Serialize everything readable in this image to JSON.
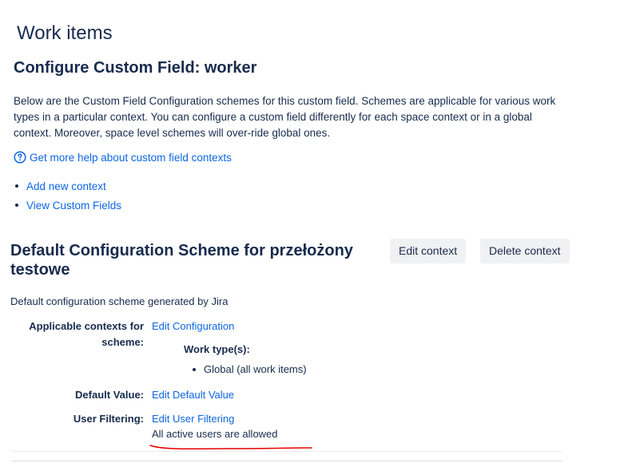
{
  "page": {
    "title": "Work items"
  },
  "section": {
    "title": "Configure Custom Field: worker",
    "intro": "Below are the Custom Field Configuration schemes for this custom field. Schemes are applicable for various work types in a particular context. You can configure a custom field differently for each space context or in a global context. Moreover, space level schemes will over-ride global ones.",
    "help_link": "Get more help about custom field contexts",
    "help_icon": "question-circle-icon",
    "links": [
      "Add new context",
      "View Custom Fields"
    ]
  },
  "scheme": {
    "title": "Default Configuration Scheme for przełożony testowe",
    "edit_context": "Edit context",
    "delete_context": "Delete context",
    "description": "Default configuration scheme generated by Jira",
    "applicable_label": "Applicable contexts for scheme:",
    "edit_configuration": "Edit Configuration",
    "work_types_label": "Work type(s):",
    "work_types": [
      "Global (all work items)"
    ],
    "default_value_label": "Default Value:",
    "edit_default_value": "Edit Default Value",
    "user_filtering_label": "User Filtering:",
    "edit_user_filtering": "Edit User Filtering",
    "user_filtering_value": "All active users are allowed"
  },
  "colors": {
    "link": "#0c66e4",
    "text": "#172b4d",
    "annotation": "#e60000",
    "button_bg": "#f0f1f3"
  }
}
